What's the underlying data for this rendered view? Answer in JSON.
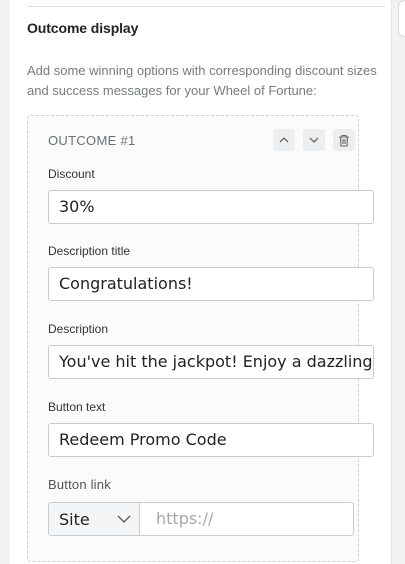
{
  "section": {
    "title": "Outcome display",
    "description": "Add some winning options with corresponding discount sizes and success messages for your Wheel of Fortune:"
  },
  "outcome": {
    "header": "OUTCOME #1",
    "fields": {
      "discount": {
        "label": "Discount",
        "value": "30%"
      },
      "title": {
        "label": "Description title",
        "value": "Congratulations!"
      },
      "description": {
        "label": "Description",
        "value": "You've hit the jackpot! Enjoy a dazzling"
      },
      "button_text": {
        "label": "Button text",
        "value": "Redeem Promo Code"
      },
      "button_link": {
        "label": "Button link",
        "select_value": "Site",
        "placeholder": "https://"
      }
    }
  },
  "icons": {
    "up": "chevron-up-icon",
    "down": "chevron-down-icon",
    "delete": "trash-icon",
    "select": "chevron-down-icon"
  }
}
